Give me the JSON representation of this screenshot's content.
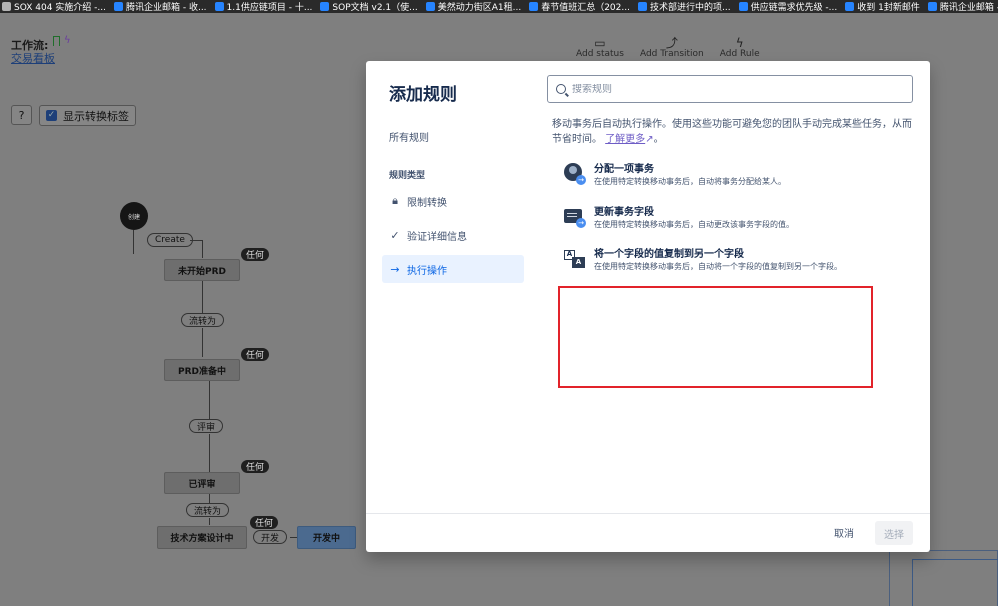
{
  "bookmarks": [
    {
      "label": "SOX 404 实施介绍 -...",
      "icon": "page-icon",
      "color": "#b3b3b3"
    },
    {
      "label": "腾讯企业邮箱 - 收...",
      "icon": "confluence-icon",
      "color": "#2684ff"
    },
    {
      "label": "1.1供应链项目 - 十...",
      "icon": "confluence-icon",
      "color": "#2684ff"
    },
    {
      "label": "SOP文档 v2.1（使...",
      "icon": "confluence-icon",
      "color": "#2684ff"
    },
    {
      "label": "美然动力街区A1租...",
      "icon": "confluence-icon",
      "color": "#2684ff"
    },
    {
      "label": "春节值班汇总（202...",
      "icon": "confluence-icon",
      "color": "#2684ff"
    },
    {
      "label": "技术部进行中的项...",
      "icon": "confluence-icon",
      "color": "#2684ff"
    },
    {
      "label": "供应链需求优先级 -...",
      "icon": "confluence-icon",
      "color": "#2684ff"
    },
    {
      "label": "收到 1封新邮件",
      "icon": "confluence-icon",
      "color": "#2684ff"
    },
    {
      "label": "腾讯企业邮箱 - 3",
      "icon": "confluence-icon",
      "color": "#2684ff"
    }
  ],
  "workflow": {
    "label": "工作流:",
    "name": "交易看板",
    "help": "?",
    "show_labels": "显示转换标签",
    "actions": [
      {
        "label": "Add status",
        "icon": "status-icon"
      },
      {
        "label": "Add Transition",
        "icon": "transition-icon"
      },
      {
        "label": "Add Rule",
        "icon": "lightning-icon"
      }
    ]
  },
  "diagram": {
    "start": "创建",
    "create": "Create",
    "any": "任何",
    "nodes": {
      "n1": "未开始PRD",
      "n2": "PRD准备中",
      "n3": "已评审",
      "n4": "技术方案设计中",
      "n5": "开发中"
    },
    "transitions": {
      "t1": "流转为",
      "t2": "评审",
      "t3": "流转为",
      "t4": "开发"
    }
  },
  "modal": {
    "title": "添加规则",
    "search_placeholder": "搜索规则",
    "side": {
      "all": "所有规则",
      "category": "规则类型",
      "items": [
        {
          "label": "限制转换",
          "icon": "lock-icon",
          "active": false
        },
        {
          "label": "验证详细信息",
          "icon": "check-icon",
          "active": false
        },
        {
          "label": "执行操作",
          "icon": "arrow-right-icon",
          "active": true
        }
      ]
    },
    "description": "移动事务后自动执行操作。使用这些功能可避免您的团队手动完成某些任务，从而节省时间。",
    "learn_more": "了解更多",
    "rules": [
      {
        "title": "分配一项事务",
        "desc": "在使用特定转换移动事务后，自动将事务分配给某人。",
        "icon": "assign-icon"
      },
      {
        "title": "更新事务字段",
        "desc": "在使用特定转换移动事务后，自动更改该事务字段的值。",
        "icon": "update-field-icon"
      },
      {
        "title": "将一个字段的值复制到另一个字段",
        "desc": "在使用特定转换移动事务后，自动将一个字段的值复制到另一个字段。",
        "icon": "copy-field-icon"
      }
    ],
    "cancel": "取消",
    "select": "选择"
  }
}
